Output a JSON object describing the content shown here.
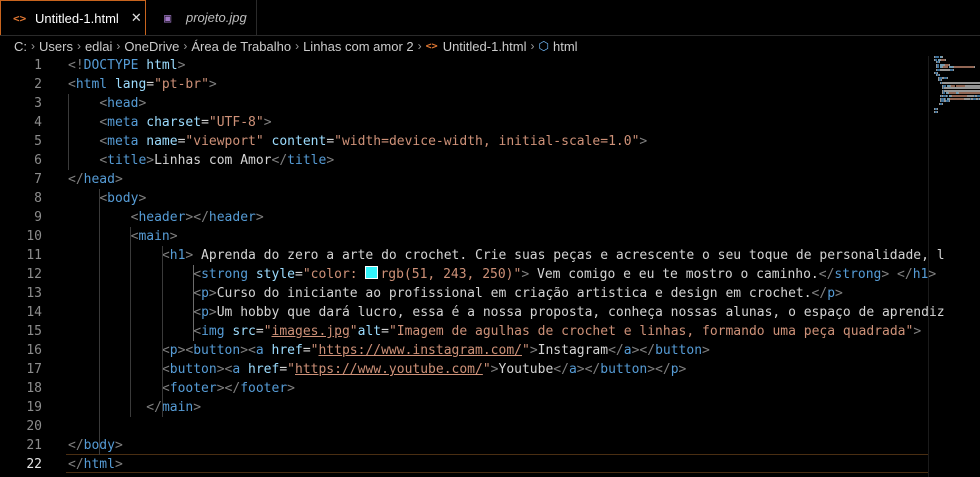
{
  "tabs": [
    {
      "icon": "<>",
      "label": "Untitled-1.html",
      "close": "✕",
      "active": true
    },
    {
      "icon": "🖼",
      "label": "projeto.jpg",
      "active": false
    }
  ],
  "breadcrumb": [
    "C:",
    "Users",
    "edlai",
    "OneDrive",
    "Área de Trabalho",
    "Linhas com amor 2",
    "Untitled-1.html",
    "html"
  ],
  "current_line": 22,
  "lines": [
    {
      "n": 1,
      "tokens": [
        [
          "g",
          "<!"
        ],
        [
          "t",
          "DOCTYPE"
        ],
        [
          "x",
          " "
        ],
        [
          "a",
          "html"
        ],
        [
          "g",
          ">"
        ]
      ]
    },
    {
      "n": 2,
      "tokens": [
        [
          "g",
          "<"
        ],
        [
          "t",
          "html"
        ],
        [
          "x",
          " "
        ],
        [
          "a",
          "lang"
        ],
        [
          "x",
          "="
        ],
        [
          "s",
          "\"pt-br\""
        ],
        [
          "g",
          ">"
        ]
      ]
    },
    {
      "n": 3,
      "tokens": [
        [
          "x",
          "    "
        ],
        [
          "g",
          "<"
        ],
        [
          "t",
          "head"
        ],
        [
          "g",
          ">"
        ]
      ]
    },
    {
      "n": 4,
      "tokens": [
        [
          "x",
          "    "
        ],
        [
          "g",
          "<"
        ],
        [
          "t",
          "meta"
        ],
        [
          "x",
          " "
        ],
        [
          "a",
          "charset"
        ],
        [
          "x",
          "="
        ],
        [
          "s",
          "\"UTF-8\""
        ],
        [
          "g",
          ">"
        ]
      ]
    },
    {
      "n": 5,
      "tokens": [
        [
          "x",
          "    "
        ],
        [
          "g",
          "<"
        ],
        [
          "t",
          "meta"
        ],
        [
          "x",
          " "
        ],
        [
          "a",
          "name"
        ],
        [
          "x",
          "="
        ],
        [
          "s",
          "\"viewport\""
        ],
        [
          "x",
          " "
        ],
        [
          "a",
          "content"
        ],
        [
          "x",
          "="
        ],
        [
          "s",
          "\"width=device-width, initial-scale=1.0\""
        ],
        [
          "g",
          ">"
        ]
      ]
    },
    {
      "n": 6,
      "tokens": [
        [
          "x",
          "    "
        ],
        [
          "g",
          "<"
        ],
        [
          "t",
          "title"
        ],
        [
          "g",
          ">"
        ],
        [
          "x",
          "Linhas com Amor"
        ],
        [
          "g",
          "</"
        ],
        [
          "t",
          "title"
        ],
        [
          "g",
          ">"
        ]
      ]
    },
    {
      "n": 7,
      "tokens": [
        [
          "g",
          "</"
        ],
        [
          "t",
          "head"
        ],
        [
          "g",
          ">"
        ]
      ]
    },
    {
      "n": 8,
      "tokens": [
        [
          "x",
          "    "
        ],
        [
          "g",
          "<"
        ],
        [
          "t",
          "body"
        ],
        [
          "g",
          ">"
        ]
      ]
    },
    {
      "n": 9,
      "tokens": [
        [
          "x",
          "        "
        ],
        [
          "g",
          "<"
        ],
        [
          "t",
          "header"
        ],
        [
          "g",
          "></"
        ],
        [
          "t",
          "header"
        ],
        [
          "g",
          ">"
        ]
      ]
    },
    {
      "n": 10,
      "tokens": [
        [
          "x",
          "        "
        ],
        [
          "g",
          "<"
        ],
        [
          "t",
          "main"
        ],
        [
          "g",
          ">"
        ]
      ]
    },
    {
      "n": 11,
      "tokens": [
        [
          "x",
          "            "
        ],
        [
          "g",
          "<"
        ],
        [
          "t",
          "h1"
        ],
        [
          "g",
          ">"
        ],
        [
          "x",
          " Aprenda do zero a arte do crochet. Crie suas peças e acrescente o seu toque de personalidade, l"
        ]
      ]
    },
    {
      "n": 12,
      "tokens": [
        [
          "x",
          "                "
        ],
        [
          "g",
          "<"
        ],
        [
          "t",
          "strong"
        ],
        [
          "x",
          " "
        ],
        [
          "a",
          "style"
        ],
        [
          "x",
          "="
        ],
        [
          "s",
          "\"color: "
        ],
        [
          "swatch",
          "#33f3fa"
        ],
        [
          "s",
          "rgb(51, 243, 250)\""
        ],
        [
          "g",
          ">"
        ],
        [
          "x",
          " Vem comigo e eu te mostro o caminho."
        ],
        [
          "g",
          "</"
        ],
        [
          "t",
          "strong"
        ],
        [
          "g",
          ">"
        ],
        [
          "x",
          " "
        ],
        [
          "g",
          "</"
        ],
        [
          "t",
          "h1"
        ],
        [
          "g",
          ">"
        ]
      ]
    },
    {
      "n": 13,
      "tokens": [
        [
          "x",
          "                "
        ],
        [
          "g",
          "<"
        ],
        [
          "t",
          "p"
        ],
        [
          "g",
          ">"
        ],
        [
          "x",
          "Curso do iniciante ao profissional em criação artistica e design em crochet."
        ],
        [
          "g",
          "</"
        ],
        [
          "t",
          "p"
        ],
        [
          "g",
          ">"
        ]
      ]
    },
    {
      "n": 14,
      "tokens": [
        [
          "x",
          "                "
        ],
        [
          "g",
          "<"
        ],
        [
          "t",
          "p"
        ],
        [
          "g",
          ">"
        ],
        [
          "x",
          "Um hobby que dará lucro, essa é a nossa proposta, conheça nossas alunas, o espaço de aprendiz"
        ]
      ]
    },
    {
      "n": 15,
      "tokens": [
        [
          "x",
          "                "
        ],
        [
          "g",
          "<"
        ],
        [
          "t",
          "img"
        ],
        [
          "x",
          " "
        ],
        [
          "a",
          "src"
        ],
        [
          "x",
          "="
        ],
        [
          "s",
          "\""
        ],
        [
          "su",
          "images.jpg"
        ],
        [
          "s",
          "\""
        ],
        [
          "a",
          "alt"
        ],
        [
          "x",
          "="
        ],
        [
          "s",
          "\"Imagem de agulhas de crochet e linhas, formando uma peça quadrada\""
        ],
        [
          "g",
          ">"
        ]
      ]
    },
    {
      "n": 16,
      "tokens": [
        [
          "x",
          "            "
        ],
        [
          "g",
          "<"
        ],
        [
          "t",
          "p"
        ],
        [
          "g",
          "><"
        ],
        [
          "t",
          "button"
        ],
        [
          "g",
          "><"
        ],
        [
          "t",
          "a"
        ],
        [
          "x",
          " "
        ],
        [
          "a",
          "href"
        ],
        [
          "x",
          "="
        ],
        [
          "s",
          "\""
        ],
        [
          "su",
          "https://www.instagram.com/"
        ],
        [
          "s",
          "\""
        ],
        [
          "g",
          ">"
        ],
        [
          "x",
          "Instagram"
        ],
        [
          "g",
          "</"
        ],
        [
          "t",
          "a"
        ],
        [
          "g",
          "></"
        ],
        [
          "t",
          "button"
        ],
        [
          "g",
          ">"
        ]
      ]
    },
    {
      "n": 17,
      "tokens": [
        [
          "x",
          "            "
        ],
        [
          "g",
          "<"
        ],
        [
          "t",
          "button"
        ],
        [
          "g",
          "><"
        ],
        [
          "t",
          "a"
        ],
        [
          "x",
          " "
        ],
        [
          "a",
          "href"
        ],
        [
          "x",
          "="
        ],
        [
          "s",
          "\""
        ],
        [
          "su",
          "https://www.youtube.com/"
        ],
        [
          "s",
          "\""
        ],
        [
          "g",
          ">"
        ],
        [
          "x",
          "Youtube"
        ],
        [
          "g",
          "</"
        ],
        [
          "t",
          "a"
        ],
        [
          "g",
          "></"
        ],
        [
          "t",
          "button"
        ],
        [
          "g",
          "></"
        ],
        [
          "t",
          "p"
        ],
        [
          "g",
          ">"
        ]
      ]
    },
    {
      "n": 18,
      "tokens": [
        [
          "x",
          "            "
        ],
        [
          "g",
          "<"
        ],
        [
          "t",
          "footer"
        ],
        [
          "g",
          "></"
        ],
        [
          "t",
          "footer"
        ],
        [
          "g",
          ">"
        ]
      ]
    },
    {
      "n": 19,
      "tokens": [
        [
          "x",
          "          "
        ],
        [
          "g",
          "</"
        ],
        [
          "t",
          "main"
        ],
        [
          "g",
          ">"
        ]
      ]
    },
    {
      "n": 20,
      "tokens": []
    },
    {
      "n": 21,
      "tokens": [
        [
          "g",
          "</"
        ],
        [
          "t",
          "body"
        ],
        [
          "g",
          ">"
        ]
      ]
    },
    {
      "n": 22,
      "tokens": [
        [
          "g",
          "</"
        ],
        [
          "t",
          "html"
        ],
        [
          "g",
          ">"
        ]
      ]
    }
  ]
}
